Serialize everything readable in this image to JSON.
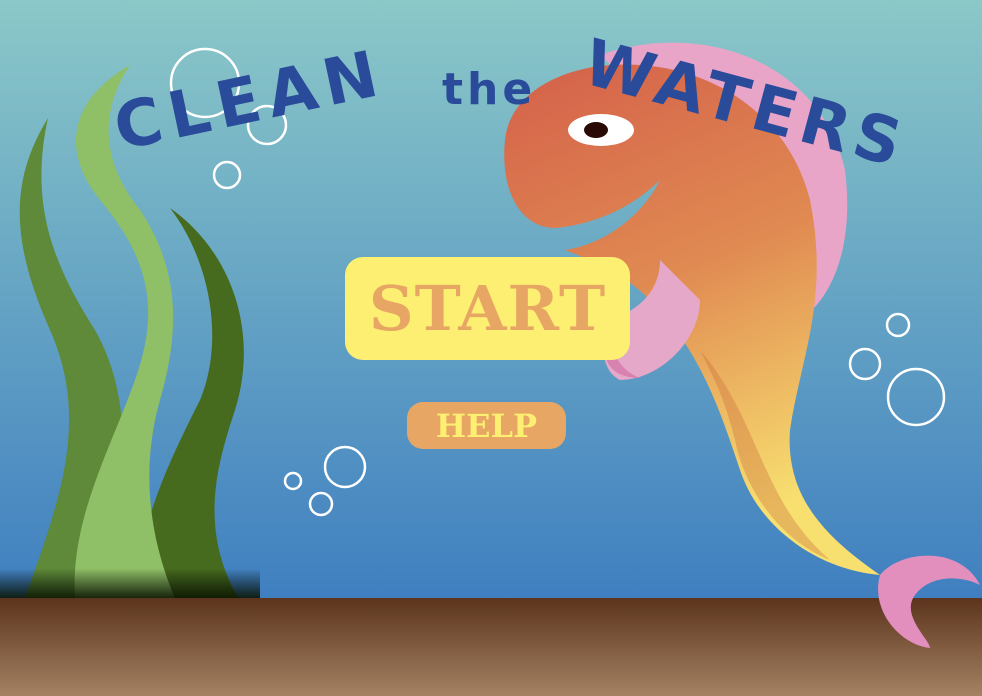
{
  "title": {
    "word1": "CLEAN",
    "word2": "the",
    "word3": "WATERS"
  },
  "menu": {
    "start_label": "START",
    "help_label": "HELP"
  },
  "colors": {
    "water_top": "#8bc8c8",
    "water_bottom": "#3f7fc0",
    "sand_top": "#5c341d",
    "sand_bottom": "#a48263",
    "title": "#2a4b9a",
    "start_bg": "#fcef72",
    "start_text": "#e7a663",
    "help_bg": "#e7a663",
    "help_text": "#fcef72",
    "fish_body": "#d9664a",
    "fish_fin": "#e29bc2"
  }
}
